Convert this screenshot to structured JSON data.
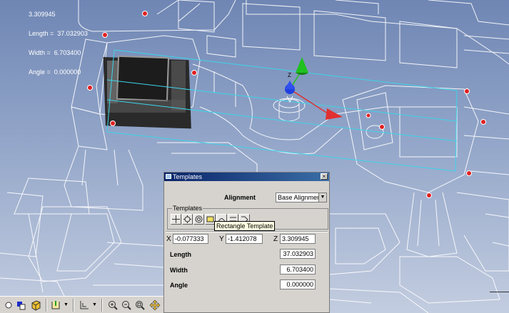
{
  "readout": {
    "line1": "3.309945",
    "line2": "Length =  37.032903",
    "line3": "Width =  6.703400",
    "line4": "Angle =  0.000000"
  },
  "axes": {
    "z_label": "Z"
  },
  "dialog": {
    "title": "Templates",
    "close_label": "×",
    "alignment_label": "Alignment",
    "alignment_value": "Base Alignmen",
    "templates_group_label": "Templates",
    "tooltip": "Rectangle Template",
    "x_label": "X",
    "x_value": "-0.077333",
    "y_label": "Y",
    "y_value": "-1.412078",
    "z_label": "Z",
    "z_value": "3.309945",
    "length_label": "Length",
    "length_value": "37.032903",
    "width_label": "Width",
    "width_value": "6.703400",
    "angle_label": "Angle",
    "angle_value": "0.000000"
  },
  "colors": {
    "wire": "#ffffff",
    "selection": "#3cd4e8",
    "point": "#e02020",
    "x_axis": "#e03030",
    "y_axis": "#20c020",
    "z_axis": "#2040e0"
  }
}
